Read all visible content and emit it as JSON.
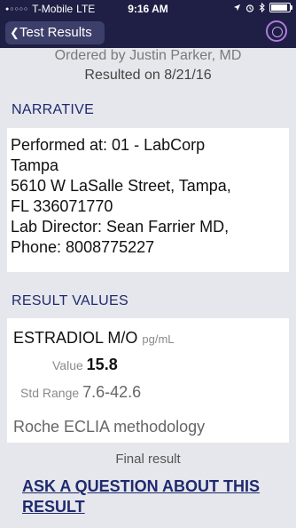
{
  "status_bar": {
    "signal_dots": "●○○○○",
    "carrier": "T-Mobile",
    "network": "LTE",
    "time": "9:16 AM",
    "location_icon": "location-arrow-icon",
    "alarm_icon": "alarm-icon",
    "bluetooth_icon": "bluetooth-icon",
    "battery_level": 0.8
  },
  "nav": {
    "back_label": "Test Results",
    "back_chevron": "❮"
  },
  "header": {
    "ordered_by": "Ordered by Justin Parker, MD",
    "resulted_on": "Resulted on 8/21/16"
  },
  "narrative": {
    "title": "NARRATIVE",
    "lines": [
      "Performed at:  01 - LabCorp",
      "Tampa",
      "5610 W LaSalle Street, Tampa,",
      "FL  336071770",
      "Lab Director: Sean Farrier MD,",
      "Phone:  8008775227"
    ]
  },
  "results": {
    "title": "RESULT VALUES",
    "test_name": "ESTRADIOL M/O",
    "unit": "pg/mL",
    "value_label": "Value",
    "value": "15.8",
    "range_label": "Std Range",
    "range": "7.6-42.6",
    "method": "Roche ECLIA methodology"
  },
  "footer": {
    "status": "Final result",
    "ask_link": "ASK A QUESTION ABOUT THIS RESULT"
  },
  "colors": {
    "nav_bg": "#1f1f45",
    "back_button_bg": "#3d3f6b",
    "accent": "#1f2a6e",
    "page_bg": "#e6e7ec"
  }
}
